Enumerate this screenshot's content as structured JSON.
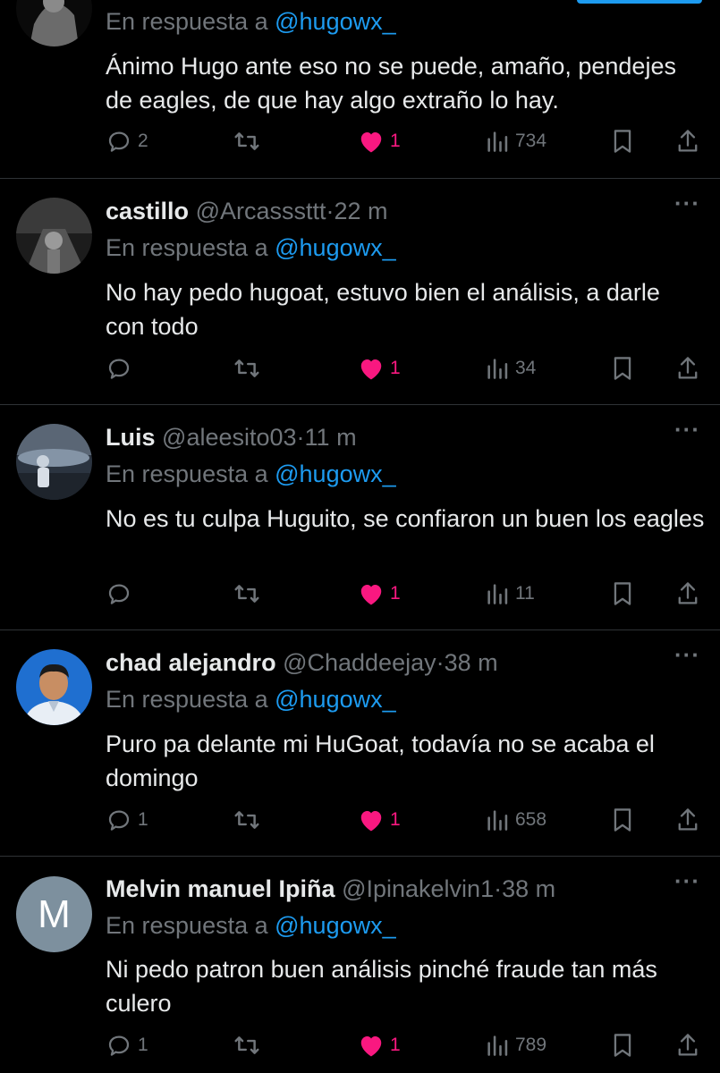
{
  "replies": [
    {
      "name": "",
      "handle": "",
      "time": "",
      "replying_prefix": "En respuesta a ",
      "replying_to": "@hugowx_",
      "text": "Ánimo Hugo ante eso no se puede, amaño, pendejes de eagles, de que hay algo extraño lo hay.",
      "replies_count": "2",
      "likes_count": "1",
      "views_count": "734",
      "avatar": "dark-figure-photo"
    },
    {
      "name": "castillo",
      "handle": "@Arcasssttt",
      "time": "22 m",
      "replying_prefix": "En respuesta a ",
      "replying_to": "@hugowx_",
      "text": "No hay pedo  hugoat, estuvo bien el análisis, a darle con todo",
      "replies_count": "",
      "likes_count": "1",
      "views_count": "34",
      "avatar": "grayscale-photo"
    },
    {
      "name": "Luis",
      "handle": "@aleesito03",
      "time": "11 m",
      "replying_prefix": "En respuesta a ",
      "replying_to": "@hugowx_",
      "text": "No es tu culpa Huguito, se confiaron un buen los eagles",
      "replies_count": "",
      "likes_count": "1",
      "views_count": "11",
      "avatar": "baseball-stadium-photo"
    },
    {
      "name": "chad alejandro",
      "handle": "@Chaddeejay",
      "time": "38 m",
      "replying_prefix": "En respuesta a ",
      "replying_to": "@hugowx_",
      "text": "Puro pa delante mi HuGoat, todavía no se acaba el domingo",
      "replies_count": "1",
      "likes_count": "1",
      "views_count": "658",
      "avatar": "portrait-blue-background"
    },
    {
      "name": "Melvin manuel Ipiña",
      "handle": "@Ipinakelvin1",
      "time": "38 m",
      "replying_prefix": "En respuesta a ",
      "replying_to": "@hugowx_",
      "text": "Ni pedo patron buen análisis pinché fraude tan más culero",
      "replies_count": "1",
      "likes_count": "1",
      "views_count": "789",
      "avatar_letter": "M"
    }
  ],
  "dot": "·",
  "more_label": "···",
  "colors": {
    "background": "#000000",
    "text": "#e7e9ea",
    "secondary": "#71767b",
    "mention": "#1d9bf0",
    "like": "#f91880",
    "border": "#2f3336"
  }
}
